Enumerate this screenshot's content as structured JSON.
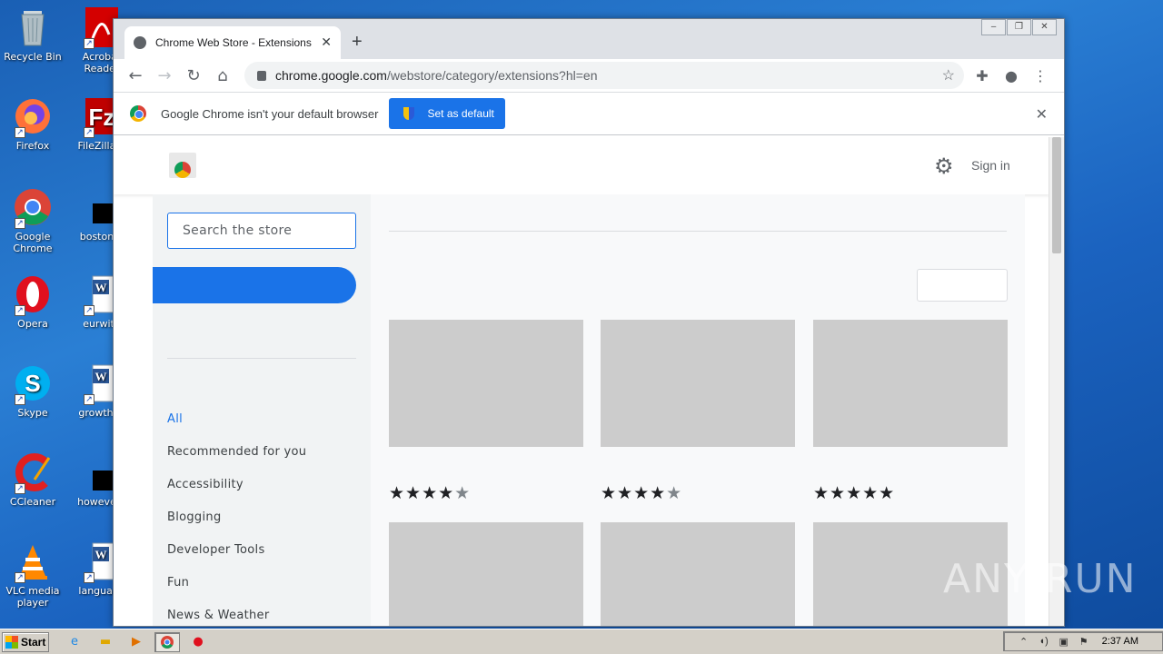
{
  "desktop": {
    "icons": [
      {
        "label": "Recycle Bin"
      },
      {
        "label": "Acrobat Reader"
      },
      {
        "label": "Firefox"
      },
      {
        "label": "FileZilla C"
      },
      {
        "label": "Google Chrome"
      },
      {
        "label": "bostonto"
      },
      {
        "label": "Opera"
      },
      {
        "label": "eurwith"
      },
      {
        "label": "Skype"
      },
      {
        "label": "growthhc"
      },
      {
        "label": "CCleaner"
      },
      {
        "label": "howevere"
      },
      {
        "label": "VLC media player"
      },
      {
        "label": "language"
      }
    ],
    "watermark": "ANY RUN"
  },
  "browser": {
    "tab_title": "Chrome Web Store - Extensions",
    "new_tab": "+",
    "url_host": "chrome.google.com",
    "url_path": "/webstore/category/extensions?hl=en",
    "infobar_text": "Google Chrome isn't your default browser",
    "set_default_label": "Set as default"
  },
  "store": {
    "signin_label": "Sign in",
    "search_placeholder": "Search the store",
    "categories": [
      "All",
      "Recommended for you",
      "Accessibility",
      "Blogging",
      "Developer Tools",
      "Fun",
      "News & Weather"
    ],
    "active_category": "All",
    "ratings": [
      3.5,
      4,
      5
    ]
  },
  "taskbar": {
    "start_label": "Start",
    "clock": "2:37 AM"
  },
  "colors": {
    "accent": "#1a73e8",
    "placeholder_card": "#cccccc",
    "desktop_blue": "#1a5fb4"
  }
}
